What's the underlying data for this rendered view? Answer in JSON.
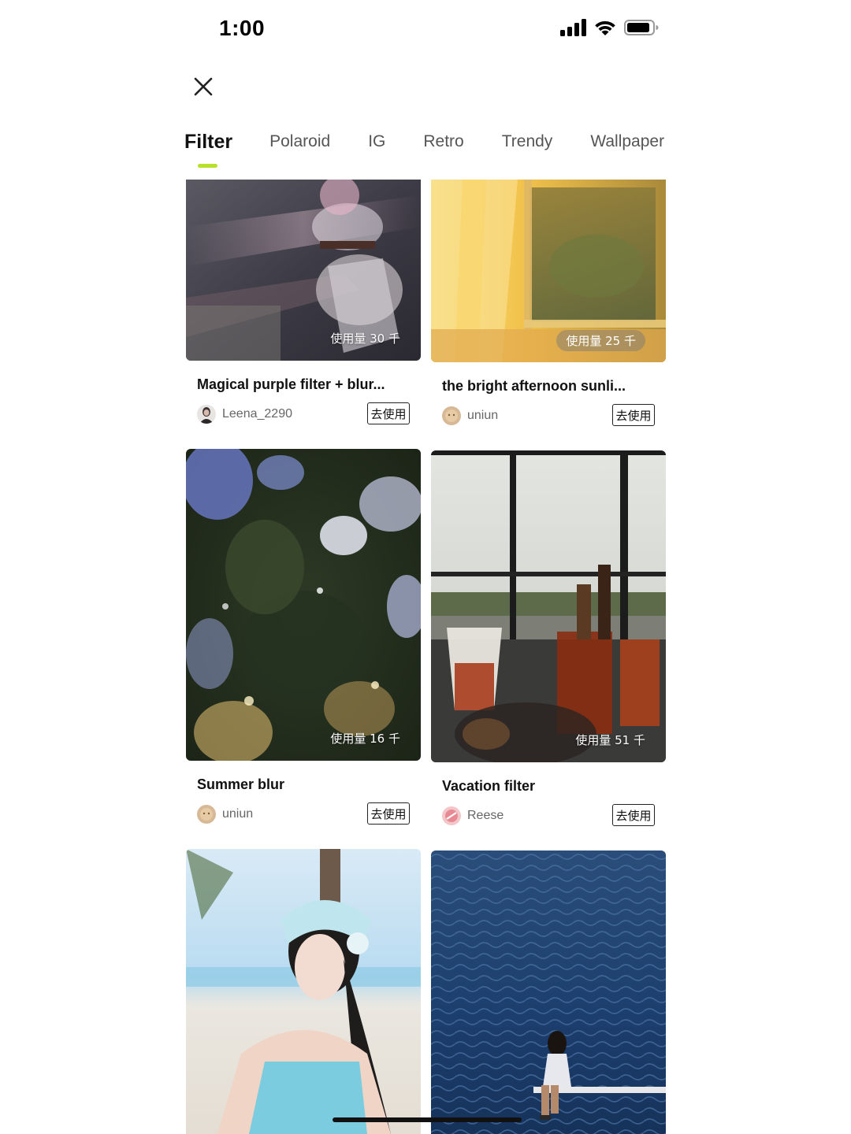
{
  "status_bar": {
    "time": "1:00",
    "icons": [
      "signal-icon",
      "wifi-icon",
      "battery-icon"
    ]
  },
  "header": {
    "close_icon": "close-icon"
  },
  "tabs": [
    {
      "label": "Filter",
      "active": true
    },
    {
      "label": "Polaroid",
      "active": false
    },
    {
      "label": "IG",
      "active": false
    },
    {
      "label": "Retro",
      "active": false
    },
    {
      "label": "Trendy",
      "active": false
    },
    {
      "label": "Wallpaper",
      "active": false
    }
  ],
  "colors": {
    "accent_underline": "#b7e029",
    "text_primary": "#111111",
    "text_secondary": "#666666"
  },
  "cards": [
    {
      "title": "Magical purple filter + blur...",
      "author": "Leena_2290",
      "usage": "使用量 30 千",
      "button": "去使用"
    },
    {
      "title": "the bright afternoon sunli...",
      "author": "uniun",
      "usage": "使用量 25 千",
      "button": "去使用"
    },
    {
      "title": "Summer blur",
      "author": "uniun",
      "usage": "使用量 16 千",
      "button": "去使用"
    },
    {
      "title": "Vacation filter",
      "author": "Reese",
      "usage": "使用量 51 千",
      "button": "去使用"
    },
    {
      "title": "",
      "author": "",
      "usage": "",
      "button": ""
    },
    {
      "title": "",
      "author": "",
      "usage": "",
      "button": ""
    }
  ]
}
